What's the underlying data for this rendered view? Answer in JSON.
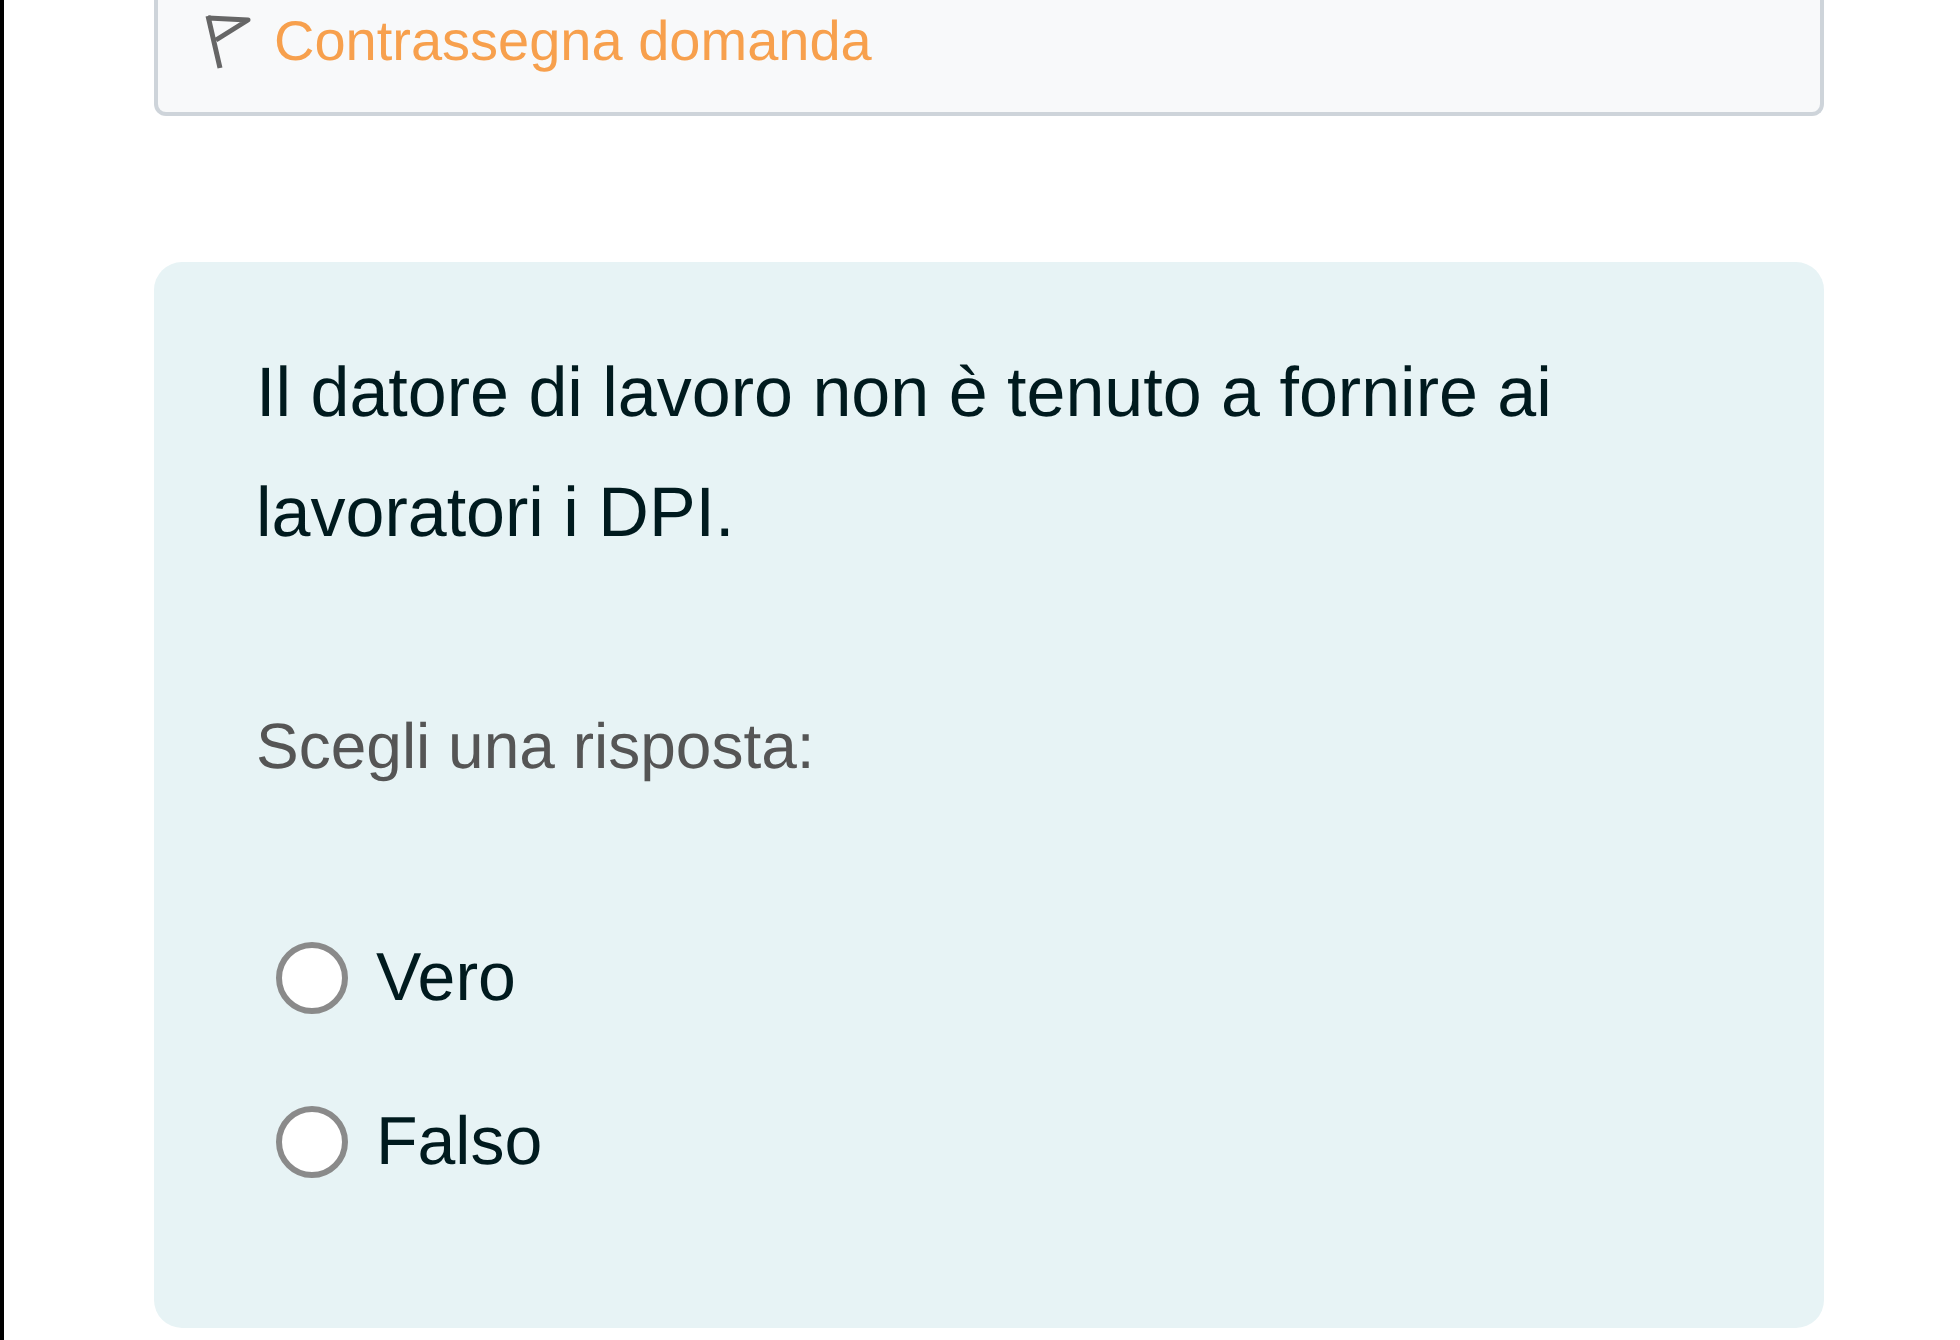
{
  "flag_box": {
    "label": "Contrassegna domanda"
  },
  "question": {
    "text": "Il datore di lavoro non è tenuto a fornire ai lavoratori i DPI.",
    "prompt": "Scegli una risposta:",
    "options": [
      {
        "label": "Vero",
        "selected": false
      },
      {
        "label": "Falso",
        "selected": false
      }
    ]
  }
}
